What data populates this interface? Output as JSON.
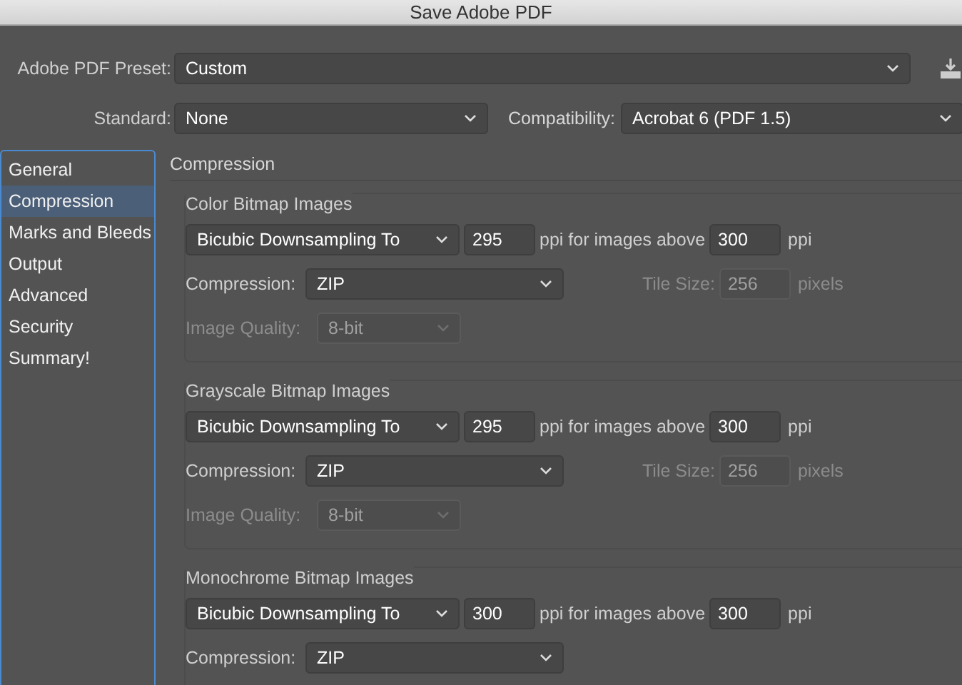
{
  "window": {
    "title": "Save Adobe PDF"
  },
  "preset": {
    "label": "Adobe PDF Preset:",
    "value": "Custom"
  },
  "standard": {
    "label": "Standard:",
    "value": "None"
  },
  "compatibility": {
    "label": "Compatibility:",
    "value": "Acrobat 6 (PDF 1.5)"
  },
  "sidebar": {
    "items": [
      {
        "label": "General",
        "selected": false
      },
      {
        "label": "Compression",
        "selected": true
      },
      {
        "label": "Marks and Bleeds",
        "selected": false
      },
      {
        "label": "Output",
        "selected": false
      },
      {
        "label": "Advanced",
        "selected": false
      },
      {
        "label": "Security",
        "selected": false
      },
      {
        "label": "Summary!",
        "selected": false
      }
    ]
  },
  "section_title": "Compression",
  "groups": [
    {
      "title": "Color Bitmap Images",
      "sampling": "Bicubic Downsampling To",
      "resolution": "295",
      "above_label": "ppi for images above",
      "above": "300",
      "unit": "ppi",
      "compression": {
        "label": "Compression:",
        "value": "ZIP"
      },
      "tile_size": {
        "label": "Tile Size:",
        "value": "256",
        "unit": "pixels",
        "disabled": true
      },
      "image_quality": {
        "label": "Image Quality:",
        "value": "8-bit",
        "disabled": true
      }
    },
    {
      "title": "Grayscale Bitmap Images",
      "sampling": "Bicubic Downsampling To",
      "resolution": "295",
      "above_label": "ppi for images above",
      "above": "300",
      "unit": "ppi",
      "compression": {
        "label": "Compression:",
        "value": "ZIP"
      },
      "tile_size": {
        "label": "Tile Size:",
        "value": "256",
        "unit": "pixels",
        "disabled": true
      },
      "image_quality": {
        "label": "Image Quality:",
        "value": "8-bit",
        "disabled": true
      }
    },
    {
      "title": "Monochrome Bitmap Images",
      "sampling": "Bicubic Downsampling To",
      "resolution": "300",
      "above_label": "ppi for images above",
      "above": "300",
      "unit": "ppi",
      "compression": {
        "label": "Compression:",
        "value": "ZIP"
      }
    }
  ]
}
